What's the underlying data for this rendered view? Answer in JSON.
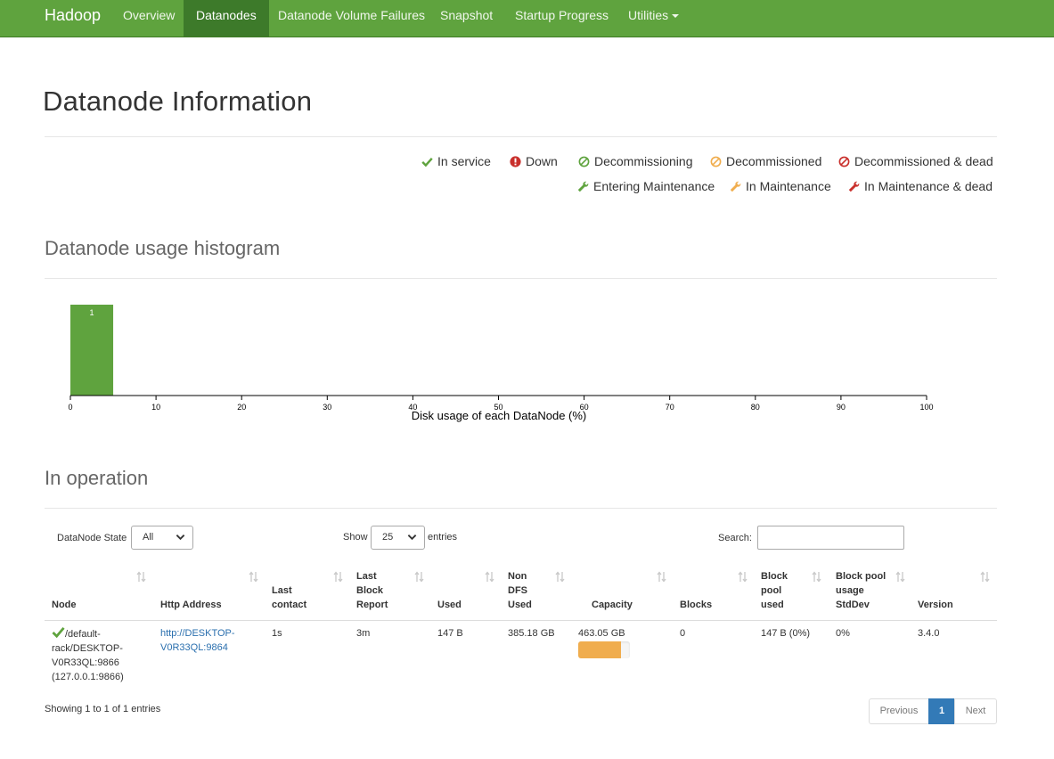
{
  "navbar": {
    "brand": "Hadoop",
    "items": [
      {
        "label": "Overview"
      },
      {
        "label": "Datanodes"
      },
      {
        "label": "Datanode Volume Failures"
      },
      {
        "label": "Snapshot"
      },
      {
        "label": "Startup Progress"
      },
      {
        "label": "Utilities"
      }
    ]
  },
  "page_title": "Datanode Information",
  "legend": [
    {
      "label": "In service",
      "icon": "check-icon",
      "color": "#5fa33e"
    },
    {
      "label": "Down",
      "icon": "exclamation-circle-icon",
      "color": "#c9302c"
    },
    {
      "label": "Decommissioning",
      "icon": "ban-icon",
      "color": "#5fa33e"
    },
    {
      "label": "Decommissioned",
      "icon": "ban-icon",
      "color": "#f0ad4e"
    },
    {
      "label": "Decommissioned & dead",
      "icon": "ban-icon",
      "color": "#c9302c"
    },
    {
      "label": "Entering Maintenance",
      "icon": "wrench-icon",
      "color": "#5fa33e"
    },
    {
      "label": "In Maintenance",
      "icon": "wrench-icon",
      "color": "#f0ad4e"
    },
    {
      "label": "In Maintenance & dead",
      "icon": "wrench-icon",
      "color": "#c9302c"
    }
  ],
  "histogram_title": "Datanode usage histogram",
  "chart_data": {
    "type": "bar",
    "bins": [
      {
        "x0": 0,
        "x1": 5,
        "count": 1
      }
    ],
    "xlabel": "Disk usage of each DataNode (%)",
    "xlim": [
      0,
      100
    ],
    "xticks": [
      "0",
      "10",
      "20",
      "30",
      "40",
      "50",
      "60",
      "70",
      "80",
      "90",
      "100"
    ],
    "bar_color": "#5fa33e"
  },
  "operation_title": "In operation",
  "controls": {
    "state_label": "DataNode State",
    "state_value": "All",
    "show_label": "Show",
    "show_value": "25",
    "entries_label": "entries",
    "search_label": "Search:"
  },
  "table": {
    "headers": [
      "Node",
      "Http Address",
      "Last contact",
      "Last Block Report",
      "Used",
      "Non DFS Used",
      "Capacity",
      "Blocks",
      "Block pool used",
      "Block pool usage StdDev",
      "Version"
    ],
    "headers_lines": [
      [
        "Node"
      ],
      [
        "Http Address"
      ],
      [
        "Last",
        "contact"
      ],
      [
        "Last",
        "Block",
        "Report"
      ],
      [
        "Used"
      ],
      [
        "Non",
        "DFS",
        "Used"
      ],
      [
        "Capacity"
      ],
      [
        "Blocks"
      ],
      [
        "Block",
        "pool",
        "used"
      ],
      [
        "Block pool",
        "usage",
        "StdDev"
      ],
      [
        "Version"
      ]
    ],
    "rows": [
      {
        "node_lines": [
          "/default-",
          "rack/DESKTOP-",
          "V0R33QL:9866",
          "(127.0.0.1:9866)"
        ],
        "http_lines": [
          "http://DESKTOP-",
          "V0R33QL:9864"
        ],
        "last_contact": "1s",
        "last_block_report": "3m",
        "used": "147 B",
        "non_dfs_used": "385.18 GB",
        "capacity": "463.05 GB",
        "capacity_used_fraction": 0.83,
        "blocks": "0",
        "block_pool_used": "147 B (0%)",
        "block_pool_stddev": "0%",
        "version": "3.4.0"
      }
    ]
  },
  "footer": {
    "showing": "Showing 1 to 1 of 1 entries",
    "previous": "Previous",
    "current_page": "1",
    "next": "Next"
  }
}
